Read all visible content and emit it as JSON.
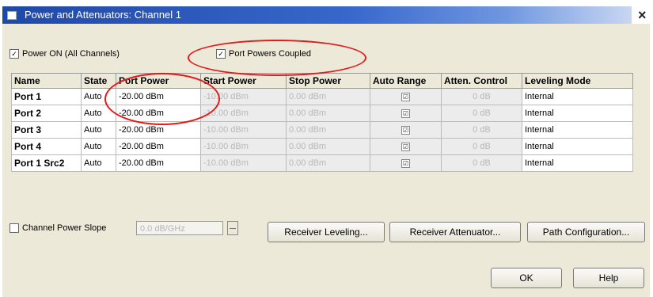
{
  "window": {
    "title": "Power and Attenuators: Channel 1"
  },
  "options": {
    "power_on_label": "Power ON (All Channels)",
    "coupled_label": "Port Powers Coupled"
  },
  "table": {
    "headers": [
      "Name",
      "State",
      "Port Power",
      "Start Power",
      "Stop Power",
      "Auto Range",
      "Atten. Control",
      "Leveling Mode"
    ],
    "rows": [
      {
        "name": "Port 1",
        "state": "Auto",
        "port_power": "-20.00 dBm",
        "start_power": "-10.00 dBm",
        "stop_power": "0.00 dBm",
        "auto_range": "☑",
        "atten": "0 dB",
        "leveling": "Internal"
      },
      {
        "name": "Port 2",
        "state": "Auto",
        "port_power": "-20.00 dBm",
        "start_power": "-10.00 dBm",
        "stop_power": "0.00 dBm",
        "auto_range": "☑",
        "atten": "0 dB",
        "leveling": "Internal"
      },
      {
        "name": "Port 3",
        "state": "Auto",
        "port_power": "-20.00 dBm",
        "start_power": "-10.00 dBm",
        "stop_power": "0.00 dBm",
        "auto_range": "☑",
        "atten": "0 dB",
        "leveling": "Internal"
      },
      {
        "name": "Port 4",
        "state": "Auto",
        "port_power": "-20.00 dBm",
        "start_power": "-10.00 dBm",
        "stop_power": "0.00 dBm",
        "auto_range": "☑",
        "atten": "0 dB",
        "leveling": "Internal"
      },
      {
        "name": "Port 1 Src2",
        "state": "Auto",
        "port_power": "-20.00 dBm",
        "start_power": "-10.00 dBm",
        "stop_power": "0.00 dBm",
        "auto_range": "☑",
        "atten": "0 dB",
        "leveling": "Internal"
      }
    ]
  },
  "slope": {
    "label": "Channel Power Slope",
    "value": "0.0 dB/GHz"
  },
  "buttons": {
    "receiver_leveling": "Receiver Leveling...",
    "receiver_attenuator": "Receiver Attenuator...",
    "path_configuration": "Path Configuration...",
    "ok": "OK",
    "help": "Help"
  }
}
